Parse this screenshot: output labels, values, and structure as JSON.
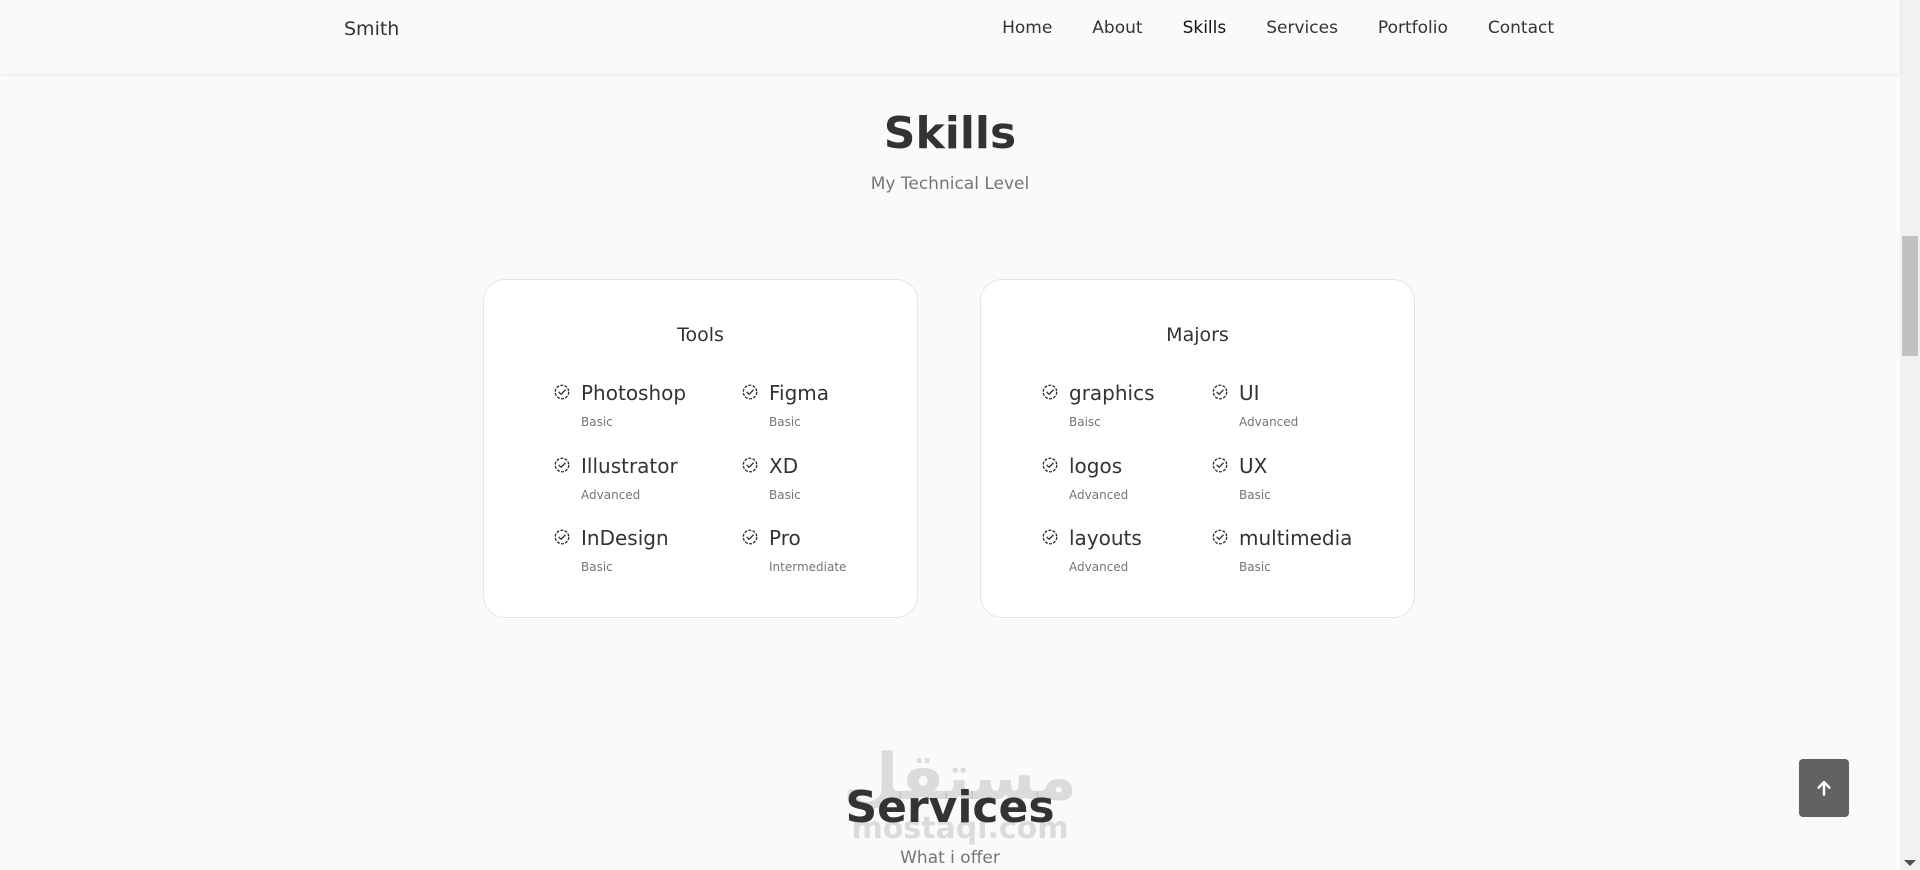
{
  "header": {
    "logo": "Smith",
    "nav": [
      {
        "label": "Home"
      },
      {
        "label": "About"
      },
      {
        "label": "Skills",
        "active": true
      },
      {
        "label": "Services"
      },
      {
        "label": "Portfolio"
      },
      {
        "label": "Contact"
      }
    ]
  },
  "skills": {
    "title": "Skills",
    "subtitle": "My Technical Level",
    "cards": [
      {
        "title": "Tools",
        "items": [
          {
            "name": "Photoshop",
            "level": "Basic"
          },
          {
            "name": "Figma",
            "level": "Basic"
          },
          {
            "name": "Illustrator",
            "level": "Advanced"
          },
          {
            "name": "XD",
            "level": "Basic"
          },
          {
            "name": "InDesign",
            "level": "Basic"
          },
          {
            "name": "Pro",
            "level": "Intermediate"
          }
        ]
      },
      {
        "title": "Majors",
        "items": [
          {
            "name": "graphics",
            "level": "Baisc"
          },
          {
            "name": "UI",
            "level": "Advanced"
          },
          {
            "name": "logos",
            "level": "Advanced"
          },
          {
            "name": "UX",
            "level": "Basic"
          },
          {
            "name": "layouts",
            "level": "Advanced"
          },
          {
            "name": "multimedia",
            "level": "Basic"
          }
        ]
      }
    ]
  },
  "services": {
    "title": "Services",
    "subtitle": "What i offer"
  },
  "watermark": {
    "arabic": "مستقل",
    "latin": "mostaql.com"
  },
  "icons": {
    "skill": "check-badge-icon",
    "back_to_top": "arrow-up-icon"
  },
  "colors": {
    "background": "#fafafa",
    "text": "#333333",
    "muted": "#757575",
    "button": "#616161"
  }
}
